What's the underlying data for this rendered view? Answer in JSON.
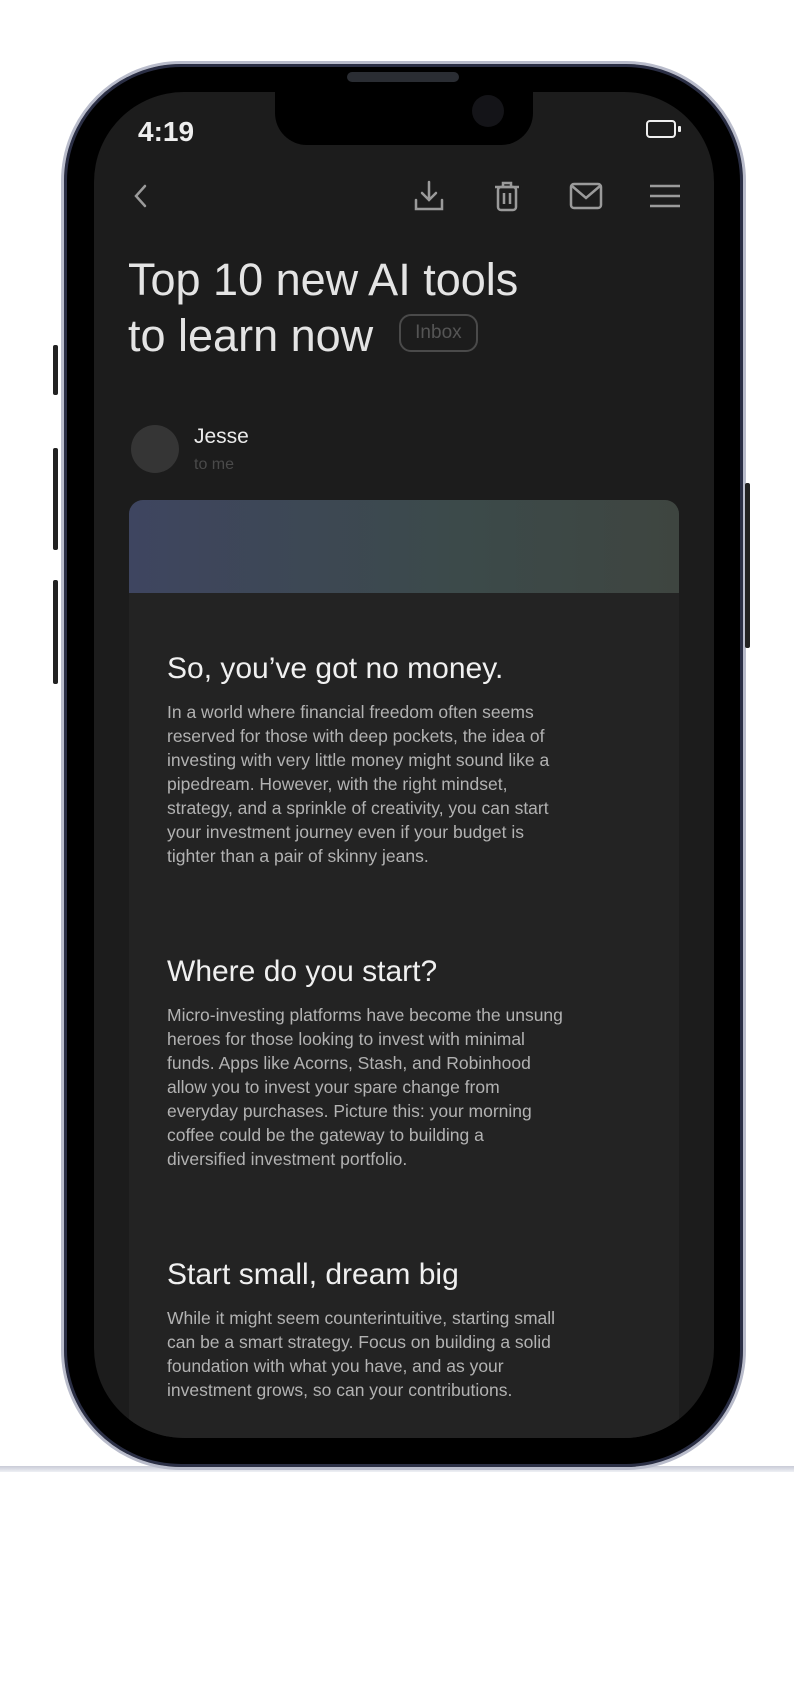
{
  "status_bar": {
    "time": "4:19"
  },
  "toolbar": {
    "icons": [
      "back-icon",
      "download-icon",
      "trash-icon",
      "mail-icon",
      "menu-icon"
    ]
  },
  "email": {
    "subject_line1": "Top 10 new AI tools",
    "subject_line2": "to learn now",
    "label": "Inbox",
    "sender": "Jesse",
    "recipient": "to me"
  },
  "body": {
    "sections": [
      {
        "heading": "So, you’ve got no money.",
        "lines": [
          "In a world where financial freedom often seems",
          "reserved for those with deep pockets, the idea of",
          "investing with very little money might sound like a",
          "pipedream. However, with the right mindset,",
          "strategy, and a sprinkle of creativity, you can start",
          "your investment journey even if your budget is",
          "tighter than a pair of skinny jeans."
        ]
      },
      {
        "heading": "Where do you start?",
        "lines": [
          "Micro-investing platforms have become the unsung",
          "heroes for those looking to invest with minimal",
          "funds. Apps like Acorns, Stash, and Robinhood",
          "allow you to invest your spare change from",
          "everyday purchases. Picture this: your morning",
          "coffee could be the gateway to building a",
          "diversified investment portfolio."
        ]
      },
      {
        "heading": "Start small, dream big",
        "lines": [
          "While it might seem counterintuitive, starting small",
          "can be a smart strategy. Focus on building a solid",
          "foundation with what you have, and as your",
          "investment grows, so can your contributions."
        ]
      }
    ]
  },
  "colors": {
    "screen_bg": "#1c1c1c",
    "card_bg": "#232323",
    "hero_gradient": [
      "#3e4560",
      "#3e4540"
    ]
  }
}
